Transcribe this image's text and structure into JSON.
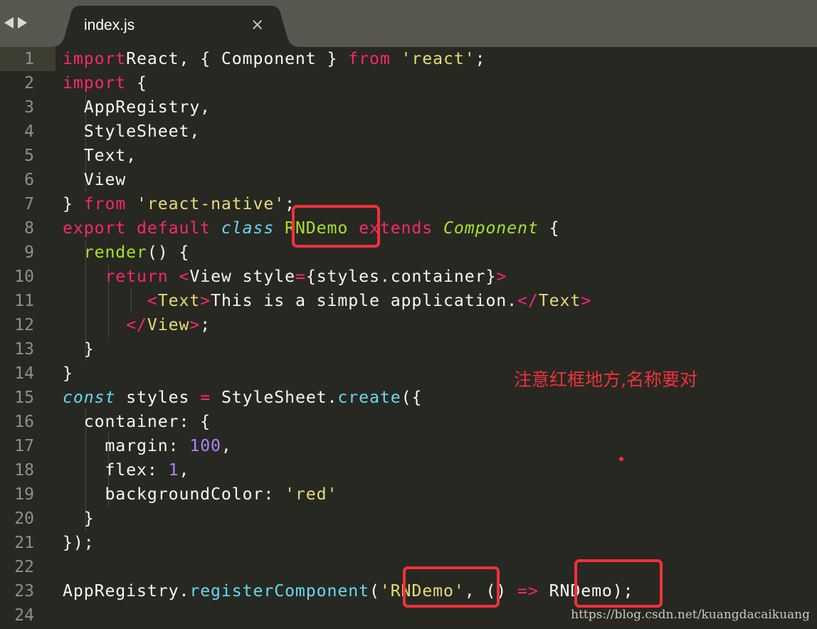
{
  "tab": {
    "filename": "index.js",
    "close_glyph": "×"
  },
  "nav": {
    "back_glyph": "back-arrow-icon",
    "forward_glyph": "forward-arrow-icon"
  },
  "line_numbers": [
    "1",
    "2",
    "3",
    "4",
    "5",
    "6",
    "7",
    "8",
    "9",
    "10",
    "11",
    "12",
    "13",
    "14",
    "15",
    "16",
    "17",
    "18",
    "19",
    "20",
    "21",
    "22",
    "23",
    "24"
  ],
  "code_lines": [
    [
      [
        "kw",
        "import"
      ],
      [
        "",
        "React, { Component } "
      ],
      [
        "kw",
        "from"
      ],
      [
        "",
        ""
      ],
      [
        "str",
        " 'react'"
      ],
      [
        "",
        ";"
      ]
    ],
    [
      [
        "kw",
        "import"
      ],
      [
        "",
        " {"
      ]
    ],
    [
      [
        "",
        "  AppRegistry,"
      ]
    ],
    [
      [
        "",
        "  StyleSheet,"
      ]
    ],
    [
      [
        "",
        "  Text,"
      ]
    ],
    [
      [
        "",
        "  View"
      ]
    ],
    [
      [
        "",
        "} "
      ],
      [
        "kw",
        "from"
      ],
      [
        "str",
        " 'react-native'"
      ],
      [
        "",
        ";"
      ]
    ],
    [
      [
        "kw",
        "export default "
      ],
      [
        "stor",
        "class"
      ],
      [
        "fn",
        " RNDemo "
      ],
      [
        "kw",
        "extends"
      ],
      [
        "cls",
        " Component"
      ],
      [
        "",
        " {"
      ]
    ],
    [
      [
        "fn",
        "  render"
      ],
      [
        "",
        "() {"
      ]
    ],
    [
      [
        "kw",
        "    return "
      ],
      [
        "tag",
        "<"
      ],
      [
        "",
        "View style"
      ],
      [
        "kw",
        "="
      ],
      [
        "",
        "{styles.container}"
      ],
      [
        "tag",
        ">"
      ]
    ],
    [
      [
        "tag",
        "        <"
      ],
      [
        "tagn",
        "Text"
      ],
      [
        "tag",
        ">"
      ],
      [
        "",
        "This is a simple application."
      ],
      [
        "tag",
        "</"
      ],
      [
        "tagn",
        "Text"
      ],
      [
        "tag",
        ">"
      ]
    ],
    [
      [
        "tag",
        "      </"
      ],
      [
        "tagn",
        "View"
      ],
      [
        "tag",
        ">"
      ],
      [
        "",
        ";"
      ]
    ],
    [
      [
        "",
        "  }"
      ]
    ],
    [
      [
        "",
        "}"
      ]
    ],
    [
      [
        "stor",
        "const"
      ],
      [
        "",
        " styles "
      ],
      [
        "kw",
        "="
      ],
      [
        "",
        " StyleSheet."
      ],
      [
        "prop",
        "create"
      ],
      [
        "",
        "({"
      ]
    ],
    [
      [
        "",
        "  container: {"
      ]
    ],
    [
      [
        "",
        "    margin: "
      ],
      [
        "num",
        "100"
      ],
      [
        "",
        ","
      ]
    ],
    [
      [
        "",
        "    flex: "
      ],
      [
        "num",
        "1"
      ],
      [
        "",
        ","
      ]
    ],
    [
      [
        "",
        "    backgroundColor: "
      ],
      [
        "str",
        "'red'"
      ]
    ],
    [
      [
        "",
        "  }"
      ]
    ],
    [
      [
        "",
        "});"
      ]
    ],
    [
      [
        "",
        ""
      ]
    ],
    [
      [
        "",
        "AppRegistry."
      ],
      [
        "prop",
        "registerComponent"
      ],
      [
        "",
        "("
      ],
      [
        "str",
        "'RNDemo'"
      ],
      [
        "",
        ", () "
      ],
      [
        "kw",
        "=>"
      ],
      [
        "",
        " RNDemo);"
      ]
    ],
    [
      [
        "",
        ""
      ]
    ]
  ],
  "annotation": {
    "text": "注意红框地方,名称要对"
  },
  "watermark": {
    "text": "https://blog.csdn.net/kuangdacaikuang"
  },
  "colors": {
    "background": "#272822",
    "keyword": "#f92672",
    "string": "#e6db74",
    "function": "#a6e22e",
    "storage": "#66d9ef",
    "number": "#ae81ff",
    "annotation_red": "#f0313a"
  }
}
